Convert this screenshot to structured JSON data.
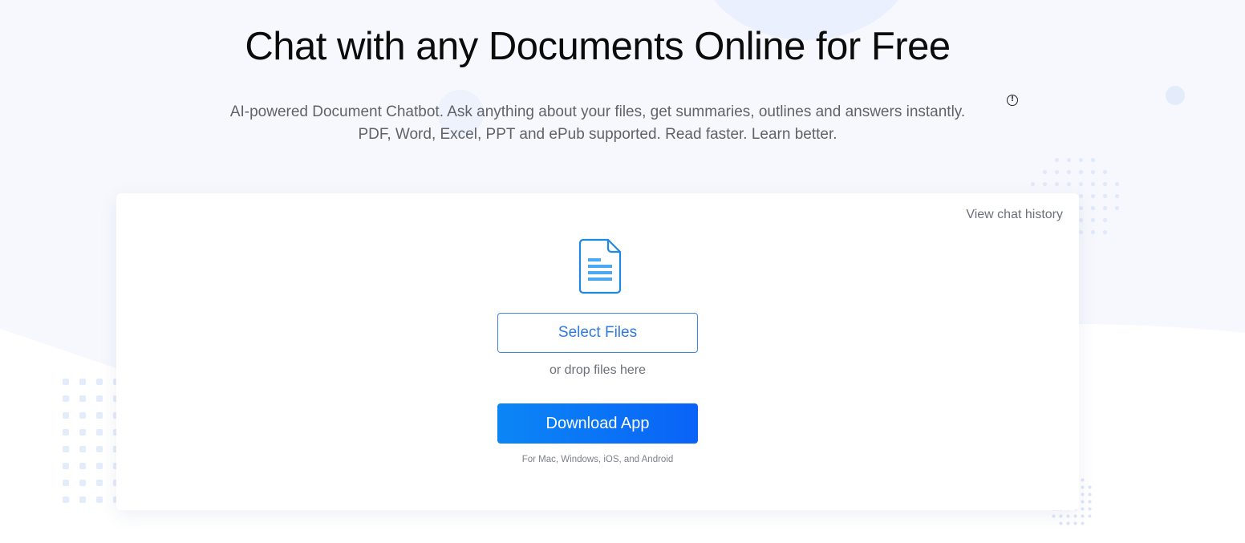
{
  "hero": {
    "title": "Chat with any Documents Online for Free",
    "subtitle_line1": "AI-powered Document Chatbot. Ask anything about your files, get summaries, outlines and answers instantly.",
    "subtitle_line2": "PDF, Word, Excel, PPT and ePub supported. Read faster. Learn better.",
    "info_icon": "info-icon",
    "info_glyph": "!"
  },
  "card": {
    "history_link": "View chat history",
    "document_icon": "document-icon",
    "select_files_label": "Select Files",
    "drop_text": "or drop files here",
    "download_label": "Download App",
    "platforms_text": "For Mac, Windows, iOS, and Android"
  },
  "colors": {
    "accent": "#0a6ff6",
    "select_border": "#3f86e0",
    "icon_blue": "#1e88e5",
    "icon_lines": "#4aa8f5",
    "page_bg": "#f6f8fd"
  }
}
